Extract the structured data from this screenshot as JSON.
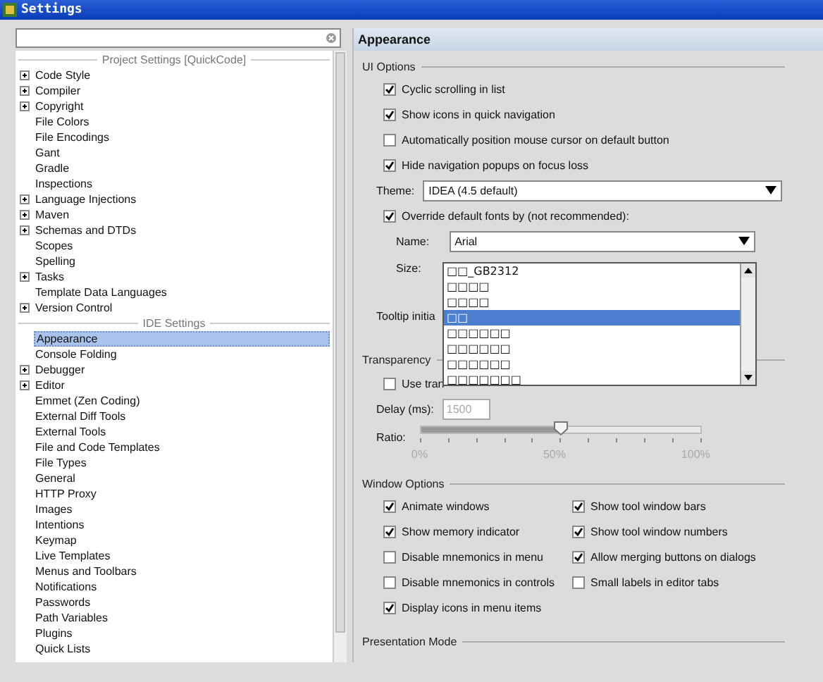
{
  "window": {
    "title": "Settings"
  },
  "tree": {
    "sections": [
      {
        "title": "Project Settings [QuickCode]",
        "items": [
          {
            "label": "Code Style",
            "has_children": true,
            "selected": false
          },
          {
            "label": "Compiler",
            "has_children": true,
            "selected": false
          },
          {
            "label": "Copyright",
            "has_children": true,
            "selected": false
          },
          {
            "label": "File Colors",
            "has_children": false,
            "selected": false
          },
          {
            "label": "File Encodings",
            "has_children": false,
            "selected": false
          },
          {
            "label": "Gant",
            "has_children": false,
            "selected": false
          },
          {
            "label": "Gradle",
            "has_children": false,
            "selected": false
          },
          {
            "label": "Inspections",
            "has_children": false,
            "selected": false
          },
          {
            "label": "Language Injections",
            "has_children": true,
            "selected": false
          },
          {
            "label": "Maven",
            "has_children": true,
            "selected": false
          },
          {
            "label": "Schemas and DTDs",
            "has_children": true,
            "selected": false
          },
          {
            "label": "Scopes",
            "has_children": false,
            "selected": false
          },
          {
            "label": "Spelling",
            "has_children": false,
            "selected": false
          },
          {
            "label": "Tasks",
            "has_children": true,
            "selected": false
          },
          {
            "label": "Template Data Languages",
            "has_children": false,
            "selected": false
          },
          {
            "label": "Version Control",
            "has_children": true,
            "selected": false
          }
        ]
      },
      {
        "title": "IDE Settings",
        "items": [
          {
            "label": "Appearance",
            "has_children": false,
            "selected": true
          },
          {
            "label": "Console Folding",
            "has_children": false,
            "selected": false
          },
          {
            "label": "Debugger",
            "has_children": true,
            "selected": false
          },
          {
            "label": "Editor",
            "has_children": true,
            "selected": false
          },
          {
            "label": "Emmet (Zen Coding)",
            "has_children": false,
            "selected": false
          },
          {
            "label": "External Diff Tools",
            "has_children": false,
            "selected": false
          },
          {
            "label": "External Tools",
            "has_children": false,
            "selected": false
          },
          {
            "label": "File and Code Templates",
            "has_children": false,
            "selected": false
          },
          {
            "label": "File Types",
            "has_children": false,
            "selected": false
          },
          {
            "label": "General",
            "has_children": false,
            "selected": false
          },
          {
            "label": "HTTP Proxy",
            "has_children": false,
            "selected": false
          },
          {
            "label": "Images",
            "has_children": false,
            "selected": false
          },
          {
            "label": "Intentions",
            "has_children": false,
            "selected": false
          },
          {
            "label": "Keymap",
            "has_children": false,
            "selected": false
          },
          {
            "label": "Live Templates",
            "has_children": false,
            "selected": false
          },
          {
            "label": "Menus and Toolbars",
            "has_children": false,
            "selected": false
          },
          {
            "label": "Notifications",
            "has_children": false,
            "selected": false
          },
          {
            "label": "Passwords",
            "has_children": false,
            "selected": false
          },
          {
            "label": "Path Variables",
            "has_children": false,
            "selected": false
          },
          {
            "label": "Plugins",
            "has_children": false,
            "selected": false
          },
          {
            "label": "Quick Lists",
            "has_children": false,
            "selected": false
          }
        ]
      }
    ]
  },
  "panel": {
    "title": "Appearance",
    "ui_options": {
      "title": "UI Options",
      "checkboxes": [
        {
          "label": "Cyclic scrolling in list",
          "checked": true
        },
        {
          "label": "Show icons in quick navigation",
          "checked": true
        },
        {
          "label": "Automatically position mouse cursor on default button",
          "checked": false
        },
        {
          "label": "Hide navigation popups on focus loss",
          "checked": true
        }
      ],
      "theme": {
        "label": "Theme:",
        "value": "IDEA (4.5 default)"
      },
      "override": {
        "label": "Override default fonts by (not recommended):",
        "checked": true
      },
      "name": {
        "label": "Name:",
        "value": "Arial"
      },
      "size": {
        "label": "Size:"
      },
      "tooltip": {
        "label": "Tooltip initia"
      }
    },
    "font_list": {
      "items": [
        {
          "label": "□□_GB2312",
          "selected": false
        },
        {
          "label": "□□□□",
          "selected": false
        },
        {
          "label": "□□□□",
          "selected": false
        },
        {
          "label": "□□",
          "selected": true
        },
        {
          "label": "□□□□□□",
          "selected": false
        },
        {
          "label": "□□□□□□",
          "selected": false
        },
        {
          "label": "□□□□□□",
          "selected": false
        },
        {
          "label": "□□□□□□□",
          "selected": false
        }
      ]
    },
    "transparency": {
      "title": "Transparency",
      "use": {
        "label": "Use tran",
        "checked": false
      },
      "delay": {
        "label": "Delay (ms):",
        "value": "1500",
        "disabled": true
      },
      "ratio": {
        "label": "Ratio:",
        "level": 0.5,
        "ticks": [
          "0%",
          "50%",
          "100%"
        ]
      }
    },
    "window_options": {
      "title": "Window Options",
      "checkboxes": [
        {
          "label": "Animate windows",
          "checked": true
        },
        {
          "label": "Show tool window bars",
          "checked": true
        },
        {
          "label": "Show memory indicator",
          "checked": true
        },
        {
          "label": "Show tool window numbers",
          "checked": true
        },
        {
          "label": "Disable mnemonics in menu",
          "checked": false
        },
        {
          "label": "Allow merging buttons on dialogs",
          "checked": true
        },
        {
          "label": "Disable mnemonics in controls",
          "checked": false
        },
        {
          "label": "Small labels in editor tabs",
          "checked": false
        },
        {
          "label": "Display icons in menu items",
          "checked": true
        }
      ]
    },
    "presentation_mode": {
      "title": "Presentation Mode"
    }
  }
}
